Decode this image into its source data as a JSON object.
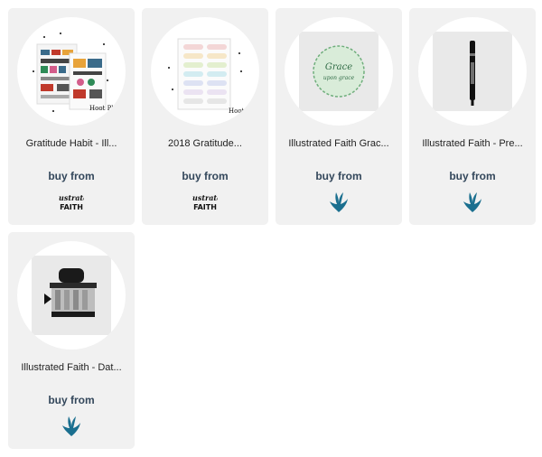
{
  "products": [
    {
      "title": "Gratitude Habit - Ill...",
      "buy_label": "buy from",
      "store_logo": "illustrated-faith-logo",
      "image": "sticker-sheets"
    },
    {
      "title": "2018 Gratitude...",
      "buy_label": "buy from",
      "store_logo": "illustrated-faith-logo",
      "image": "label-sticker-sheet"
    },
    {
      "title": "Illustrated Faith Grac...",
      "buy_label": "buy from",
      "store_logo": "blue-splash-logo",
      "image": "grace-stamp-print"
    },
    {
      "title": "Illustrated Faith - Pre...",
      "buy_label": "buy from",
      "store_logo": "blue-splash-logo",
      "image": "black-pen"
    },
    {
      "title": "Illustrated Faith - Dat...",
      "buy_label": "buy from",
      "store_logo": "blue-splash-logo",
      "image": "date-stamp"
    }
  ],
  "logo_text": {
    "line1": "Illustrated",
    "line2": "FAITH"
  },
  "stamp_text": {
    "line1": "Grace",
    "line2": "upon grace"
  },
  "colors": {
    "card_bg": "#f1f1f1",
    "buy_text": "#33475b",
    "splash_blue": "#1a6f8f"
  }
}
